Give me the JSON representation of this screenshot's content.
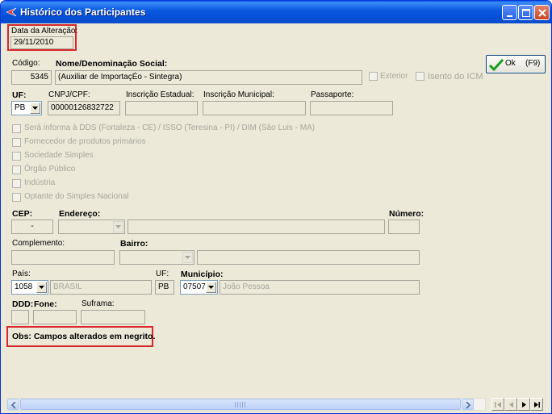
{
  "window": {
    "title": "Histórico dos Participantes"
  },
  "date": {
    "label": "Data da Alteração:",
    "value": "29/11/2010"
  },
  "codigo": {
    "label": "Código:",
    "value": "5345"
  },
  "nome": {
    "label": "Nome/Denominação Social:",
    "value": "(Auxiliar de ImportaçÉo - Sintegra)"
  },
  "checks_top": {
    "exterior": "Exterior",
    "isento": "Isento do ICM"
  },
  "ok_button": {
    "label": "Ok",
    "shortcut": "(F9)"
  },
  "uf": {
    "label": "UF:",
    "value": "PB"
  },
  "cnpj": {
    "label": "CNPJ/CPF:",
    "value": "00000126832722"
  },
  "ie": {
    "label": "Inscrição Estadual:",
    "value": ""
  },
  "im": {
    "label": "Inscrição Municipal:",
    "value": ""
  },
  "passaporte": {
    "label": "Passaporte:",
    "value": ""
  },
  "options": [
    "Será informa à DDS (Fortaleza - CE) / ISSO (Teresina - PI) / DIM (São Luis - MA)",
    "Fornecedor de produtos primários",
    "Sociedade Simples",
    "Órgão Público",
    "Indústria",
    "Optante do Simples Nacional"
  ],
  "cep": {
    "label": "CEP:",
    "value": "-"
  },
  "endereco": {
    "label": "Endereço:",
    "value": ""
  },
  "numero": {
    "label": "Número:",
    "value": ""
  },
  "complemento": {
    "label": "Complemento:",
    "value": ""
  },
  "bairro": {
    "label": "Bairro:",
    "value": ""
  },
  "pais": {
    "label": "País:",
    "code": "1058",
    "name": "BRASIL"
  },
  "uf2": {
    "label": "UF:",
    "value": "PB"
  },
  "municipio": {
    "label": "Município:",
    "code": "07507",
    "name": "João Pessoa"
  },
  "ddd": {
    "label": "DDD:",
    "value": ""
  },
  "fone": {
    "label": "Fone:",
    "value": ""
  },
  "suframa": {
    "label": "Suframa:",
    "value": ""
  },
  "obs": "Obs: Campos alterados em negrito.",
  "icons": {
    "app": "red-arrow-icon",
    "minimize": "minimize-icon",
    "maximize": "maximize-icon",
    "close": "close-icon",
    "ok": "green-check-icon",
    "dropdown": "chevron-down-icon",
    "nav_first": "first-record-icon",
    "nav_prev": "prev-record-icon",
    "nav_next": "next-record-icon",
    "nav_last": "last-record-icon"
  },
  "colors": {
    "titlebar": "#0450d8",
    "window_bg": "#ece9d8",
    "highlight_box": "#d8262b",
    "ok_check": "#1a9e1a"
  }
}
